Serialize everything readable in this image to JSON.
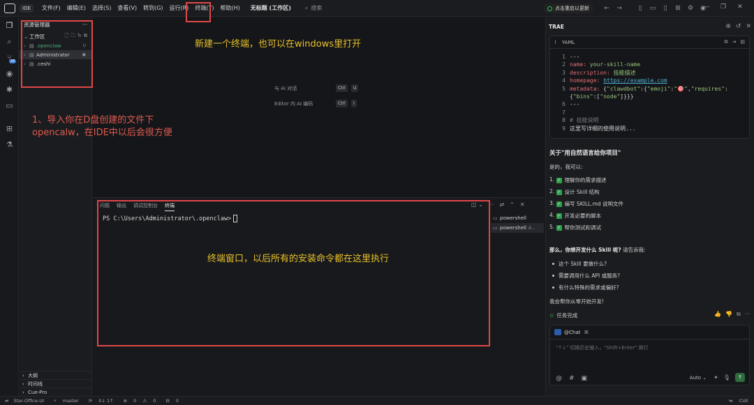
{
  "titlebar": {
    "logo_text": "IDE",
    "ide_tag": "IDE",
    "menus": [
      "文件(F)",
      "编辑(E)",
      "选择(S)",
      "查看(V)",
      "转到(G)",
      "运行(R)",
      "终端(T)",
      "帮助(H)"
    ],
    "project_title": "无标题 (工作区)",
    "search_label": "搜索",
    "update_label": "点击重启以更新"
  },
  "explorer": {
    "title": "资源管理器",
    "workspace_label": "工作区",
    "items": [
      {
        "name": ".openclaw",
        "status": "U"
      },
      {
        "name": "Administrator",
        "status": "●"
      },
      {
        "name": ".ceshi",
        "status": ""
      }
    ],
    "bottom_sections": [
      "大纲",
      "时间线",
      "Cue-Pro"
    ]
  },
  "activity": {
    "badge": "28"
  },
  "editor": {
    "shortcuts": [
      {
        "label": "与 AI 对话",
        "keys": [
          "Ctrl",
          "U"
        ]
      },
      {
        "label": "Editor 内 AI 编码",
        "keys": [
          "Ctrl",
          "I"
        ]
      }
    ]
  },
  "panel": {
    "tabs": [
      "问题",
      "输出",
      "调试控制台",
      "终端"
    ],
    "active_tab": "终端",
    "prompt": "PS C:\\Users\\Administrator\\.openclaw>",
    "terminals": [
      {
        "name": "powershell",
        "suffix": "",
        "active": false
      },
      {
        "name": "powershell",
        "suffix": "A...",
        "active": true
      }
    ]
  },
  "chat": {
    "title": "TRAE",
    "code_lang": "YAML",
    "code_lines": [
      {
        "n": "1",
        "parts": [
          {
            "t": "---",
            "c": "v"
          }
        ]
      },
      {
        "n": "2",
        "parts": [
          {
            "t": "name:",
            "c": "k"
          },
          {
            "t": " your-skill-name",
            "c": "s"
          }
        ]
      },
      {
        "n": "3",
        "parts": [
          {
            "t": "description:",
            "c": "k"
          },
          {
            "t": " 技能描述",
            "c": "s"
          }
        ]
      },
      {
        "n": "4",
        "parts": [
          {
            "t": "homepage:",
            "c": "k"
          },
          {
            "t": " ",
            "c": "v"
          },
          {
            "t": "https://example.com",
            "c": "u"
          }
        ]
      },
      {
        "n": "5",
        "parts": [
          {
            "t": "metadata:",
            "c": "k"
          },
          {
            "t": " {",
            "c": "v"
          },
          {
            "t": "\"clawdbot\"",
            "c": "s"
          },
          {
            "t": ":{",
            "c": "v"
          },
          {
            "t": "\"emoji\"",
            "c": "s"
          },
          {
            "t": ":",
            "c": "v"
          },
          {
            "t": "\"🎯\"",
            "c": "s"
          },
          {
            "t": ",",
            "c": "v"
          },
          {
            "t": "\"requires\"",
            "c": "s"
          },
          {
            "t": ":",
            "c": "v"
          }
        ]
      },
      {
        "n": "",
        "parts": [
          {
            "t": "{",
            "c": "v"
          },
          {
            "t": "\"bins\"",
            "c": "s"
          },
          {
            "t": ":[",
            "c": "v"
          },
          {
            "t": "\"node\"",
            "c": "s"
          },
          {
            "t": "]}}}",
            "c": "v"
          }
        ]
      },
      {
        "n": "6",
        "parts": [
          {
            "t": "---",
            "c": "v"
          }
        ]
      },
      {
        "n": "7",
        "parts": [
          {
            "t": "",
            "c": "v"
          }
        ]
      },
      {
        "n": "8",
        "parts": [
          {
            "t": "# 技能说明",
            "c": "c"
          }
        ]
      },
      {
        "n": "9",
        "parts": [
          {
            "t": "这里写详细的使用说明...",
            "c": "v"
          }
        ]
      }
    ],
    "heading": "关于\"用自然语言给你项目\"",
    "intro": "是的，我可以:",
    "checklist": [
      {
        "n": "1.",
        "text": "理解你的需求描述"
      },
      {
        "n": "2.",
        "text": "设计 Skill 结构"
      },
      {
        "n": "3.",
        "text": "编写 SKILL.md 说明文件"
      },
      {
        "n": "4.",
        "text": "开发必要的脚本"
      },
      {
        "n": "5.",
        "text": "帮你测试和调试"
      }
    ],
    "question_bold": "那么，你想开发什么 Skill 呢?",
    "question_rest": " 请告诉我:",
    "bullets": [
      "这个 Skill 要做什么?",
      "需要调用什么 API 或服务?",
      "有什么特殊的需求或偏好?"
    ],
    "closing": "我会帮你从零开始开发!",
    "task_done": "任务完成",
    "chip_label": "@Chat",
    "input_placeholder": "\"↑↓\" 切换历史输入，\"Shift+Enter\" 换行",
    "model_label": "Auto"
  },
  "statusbar": {
    "repo": "Star-Office-UI",
    "branch": "master",
    "sync": "0↓ 1↑",
    "errors": "0",
    "warnings": "0",
    "ports": "0",
    "right": "CUE"
  },
  "annotations": {
    "terminal_menu_note": "新建一个终端，也可以在windows里打开",
    "import_note_line1": "1、导入你在D盘创建的文件下",
    "import_note_line2": "opencalw，在IDE中以后会很方便",
    "terminal_window_note": "终端窗口，以后所有的安装命令都在这里执行"
  },
  "colors": {
    "annotation_yellow": "#e8c22a",
    "annotation_red": "#e05a4e",
    "highlight_box": "#e04848",
    "accent_green": "#2fa24f"
  }
}
